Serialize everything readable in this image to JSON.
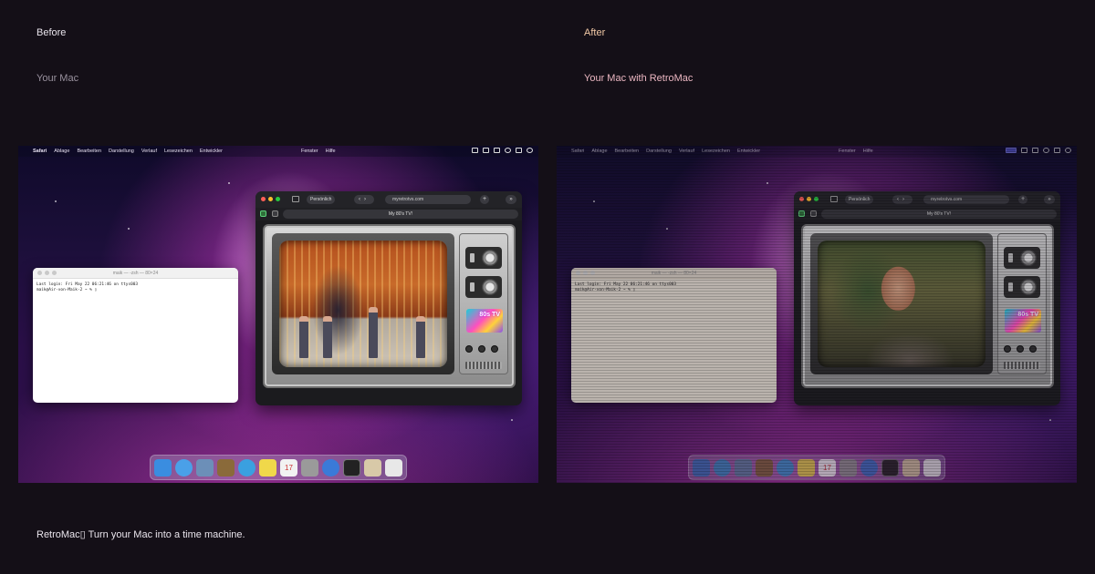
{
  "before": {
    "label": "Before",
    "subtitle": "Your Mac"
  },
  "after": {
    "label": "After",
    "subtitle": "Your Mac with RetroMac"
  },
  "tagline": "RetroMac▯ Turn your Mac into a time machine.",
  "menubar": {
    "app_name": "Safari",
    "items": [
      "Ablage",
      "Bearbeiten",
      "Darstellung",
      "Verlauf",
      "Lesezeichen",
      "Entwickler"
    ],
    "right_items": [
      "Fenster",
      "Hilfe"
    ]
  },
  "terminal": {
    "title": "maik — -zsh — 80×24",
    "line1": "Last login: Fri May 22 06:21:46 on ttys003",
    "line2": "maik@Air-von-Maik-2 ~ % ▯"
  },
  "safari": {
    "profile": "Persönlich",
    "url": "myretrotvs.com",
    "tab_title": "My 80's TV!"
  },
  "tv": {
    "sticker_text": "80s TV"
  },
  "dock": {
    "icons": [
      "finder-icon",
      "safari-icon",
      "preview-icon",
      "photos-icon",
      "messages-icon",
      "notes-icon",
      "calendar-icon",
      "image-capture-icon",
      "music-icon",
      "terminal-icon",
      "script-editor-icon",
      "textedit-icon"
    ]
  },
  "colors": {
    "background": "#140f17",
    "after_label": "#f2c9a6",
    "after_subtitle": "#ecb7c2"
  }
}
